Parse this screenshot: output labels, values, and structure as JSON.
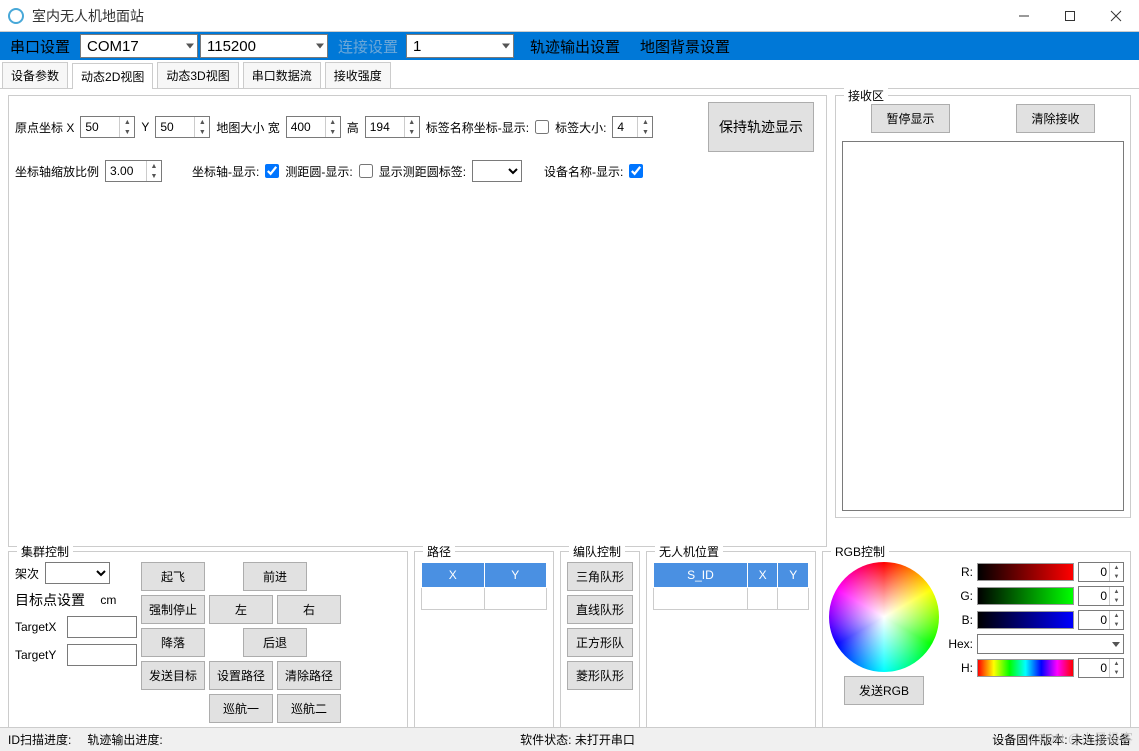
{
  "window": {
    "title": "室内无人机地面站"
  },
  "menubar": {
    "serial_label": "串口设置",
    "com": "COM17",
    "baud": "115200",
    "connect_label": "连接设置",
    "conn_val": "1",
    "track_out": "轨迹输出设置",
    "map_bg": "地图背景设置"
  },
  "tabs": [
    "设备参数",
    "动态2D视图",
    "动态3D视图",
    "串口数据流",
    "接收强度"
  ],
  "params": {
    "origin_label": "原点坐标 X",
    "x": "50",
    "y_label": "Y",
    "y": "50",
    "mapsize_label": "地图大小 宽",
    "w": "400",
    "h_label": "高",
    "h": "194",
    "tagcoord_label": "标签名称坐标-显示:",
    "tagsize_label": "标签大小:",
    "tagsize": "4",
    "scale_label": "坐标轴缩放比例",
    "scale": "3.00",
    "axis_label": "坐标轴-显示:",
    "circle_label": "测距圆-显示:",
    "circle_tag_label": "显示测距圆标签:",
    "devname_label": "设备名称-显示:",
    "keep_track": "保持轨迹显示"
  },
  "rx": {
    "title": "接收区",
    "pause": "暂停显示",
    "clear": "清除接收"
  },
  "cluster": {
    "title": "集群控制",
    "frame_label": "架次",
    "target_hdr": "目标点设置",
    "unit": "cm",
    "tx": "TargetX",
    "ty": "TargetY",
    "takeoff": "起飞",
    "estop": "强制停止",
    "land": "降落",
    "send_target": "发送目标",
    "forward": "前进",
    "left": "左",
    "right": "右",
    "back": "后退",
    "set_path": "设置路径",
    "clear_path": "清除路径",
    "cruise1": "巡航一",
    "cruise2": "巡航二"
  },
  "path": {
    "title": "路径",
    "x": "X",
    "y": "Y"
  },
  "formation": {
    "title": "编队控制",
    "tri": "三角队形",
    "line": "直线队形",
    "square": "正方形队",
    "diamond": "菱形队形"
  },
  "pos": {
    "title": "无人机位置",
    "sid": "S_ID",
    "x": "X",
    "y": "Y"
  },
  "rgb": {
    "title": "RGB控制",
    "r": "R:",
    "g": "G:",
    "b": "B:",
    "hex": "Hex:",
    "h": "H:",
    "r_val": "0",
    "g_val": "0",
    "b_val": "0",
    "h_val": "0",
    "send": "发送RGB"
  },
  "status": {
    "id_scan": "ID扫描进度:",
    "track_out": "轨迹输出进度:",
    "sw_state_label": "软件状态:",
    "sw_state": "未打开串口",
    "fw_label": "设备固件版本:",
    "fw": "未连接设备"
  },
  "watermark": "CSDN @火星极客"
}
